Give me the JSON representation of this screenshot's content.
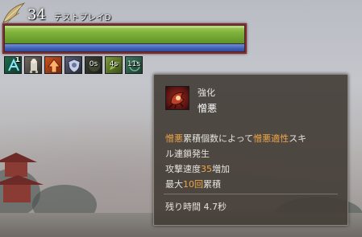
{
  "player": {
    "level": "34",
    "name": "テストプレイD",
    "hp_fraction": 1.0,
    "mp_fraction": 1.0
  },
  "buffs": [
    {
      "icon": "blue-rune-icon",
      "stack": "1",
      "timer": ""
    },
    {
      "icon": "armor-figure-icon",
      "stack": "",
      "timer": ""
    },
    {
      "icon": "orange-arrow-up-icon",
      "stack": "",
      "timer": ""
    },
    {
      "icon": "shield-emblem-icon",
      "stack": "",
      "timer": ""
    },
    {
      "icon": "dark-buff-icon",
      "stack": "",
      "timer": "0s"
    },
    {
      "icon": "green-buff-icon",
      "stack": "",
      "timer": "4s"
    },
    {
      "icon": "teal-buff-icon",
      "stack": "",
      "timer": "11s"
    }
  ],
  "tooltip": {
    "type_label": "強化",
    "name": "憎悪",
    "desc": {
      "l1_a": "憎悪",
      "l1_b": "累積個数によって",
      "l1_c": "憎悪適性",
      "l1_d": "スキ",
      "l2": "ル連鎖発生",
      "l3_a": "攻撃速度",
      "l3_b": "35",
      "l3_c": "増加",
      "l4_a": "最大",
      "l4_b": "10回",
      "l4_c": "累積"
    },
    "remaining": "残り時間 4.7秒"
  },
  "colors": {
    "highlight": "#f0a645",
    "hp": "#7fb23a",
    "mp": "#3f5fb4",
    "frame_border": "#8a2a2f"
  }
}
